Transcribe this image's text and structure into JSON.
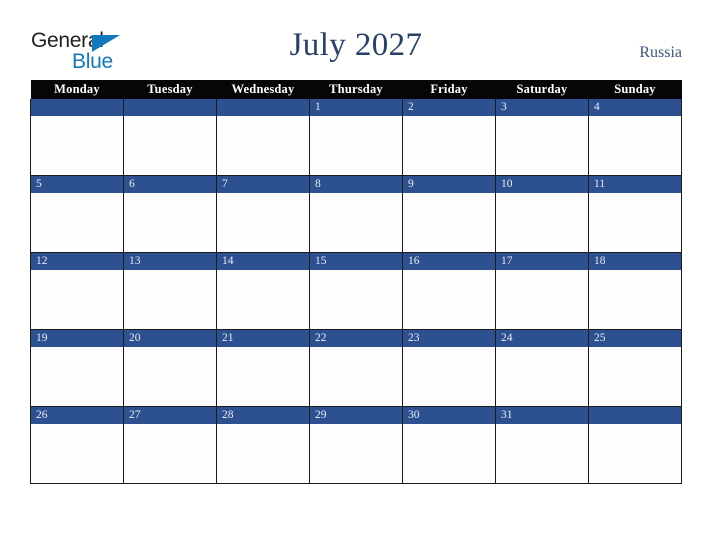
{
  "logo": {
    "word1": "General",
    "word2": "Blue",
    "triangle_color": "#1278be",
    "text_color": "#231f20"
  },
  "header": {
    "title": "July 2027",
    "country": "Russia",
    "title_color": "#27416b"
  },
  "calendar": {
    "weekday_headers": [
      "Monday",
      "Tuesday",
      "Wednesday",
      "Thursday",
      "Friday",
      "Saturday",
      "Sunday"
    ],
    "header_bg": "#060608",
    "daybar_bg": "#2d5190",
    "daybar_text_color": "#e8ecf4",
    "cell_bg": "#fdfdfd",
    "weeks": [
      {
        "days": [
          "",
          "",
          "",
          "1",
          "2",
          "3",
          "4"
        ]
      },
      {
        "days": [
          "5",
          "6",
          "7",
          "8",
          "9",
          "10",
          "11"
        ]
      },
      {
        "days": [
          "12",
          "13",
          "14",
          "15",
          "16",
          "17",
          "18"
        ]
      },
      {
        "days": [
          "19",
          "20",
          "21",
          "22",
          "23",
          "24",
          "25"
        ]
      },
      {
        "days": [
          "26",
          "27",
          "28",
          "29",
          "30",
          "31",
          ""
        ]
      }
    ]
  }
}
